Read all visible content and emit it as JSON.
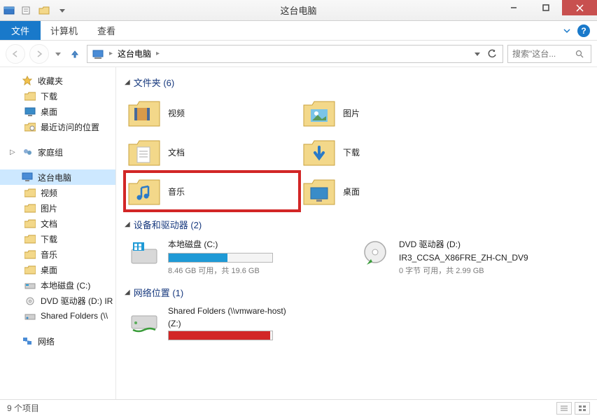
{
  "window": {
    "title": "这台电脑"
  },
  "ribbon": {
    "file": "文件",
    "tabs": [
      "计算机",
      "查看"
    ]
  },
  "addressbar": {
    "root": "这台电脑",
    "search_placeholder": "搜索\"这台..."
  },
  "sidebar": {
    "favorites": {
      "label": "收藏夹",
      "items": [
        "下载",
        "桌面",
        "最近访问的位置"
      ]
    },
    "homegroup": {
      "label": "家庭组"
    },
    "thispc": {
      "label": "这台电脑",
      "items": [
        "视频",
        "图片",
        "文档",
        "下载",
        "音乐",
        "桌面",
        "本地磁盘 (C:)",
        "DVD 驱动器 (D:) IR",
        "Shared Folders (\\\\"
      ]
    },
    "network": {
      "label": "网络"
    }
  },
  "content": {
    "folders_header": "文件夹 (6)",
    "devices_header": "设备和驱动器 (2)",
    "network_header": "网络位置 (1)",
    "folders": [
      {
        "label": "视频",
        "icon": "video"
      },
      {
        "label": "图片",
        "icon": "picture"
      },
      {
        "label": "文档",
        "icon": "document"
      },
      {
        "label": "下载",
        "icon": "download"
      },
      {
        "label": "音乐",
        "icon": "music",
        "highlighted": true
      },
      {
        "label": "桌面",
        "icon": "desktop"
      }
    ],
    "devices": [
      {
        "name": "本地磁盘 (C:)",
        "sub": "8.46 GB 可用，共 19.6 GB",
        "fill": 57,
        "color": "#1f9ad6"
      },
      {
        "name": "DVD 驱动器 (D:)",
        "line2": "IR3_CCSA_X86FRE_ZH-CN_DV9",
        "sub": "0 字节 可用，共 2.99 GB"
      }
    ],
    "network_locations": [
      {
        "name": "Shared Folders (\\\\vmware-host)",
        "line2": "(Z:)",
        "fill": 98,
        "color": "#d22626"
      }
    ]
  },
  "status": {
    "text": "9 个项目"
  }
}
